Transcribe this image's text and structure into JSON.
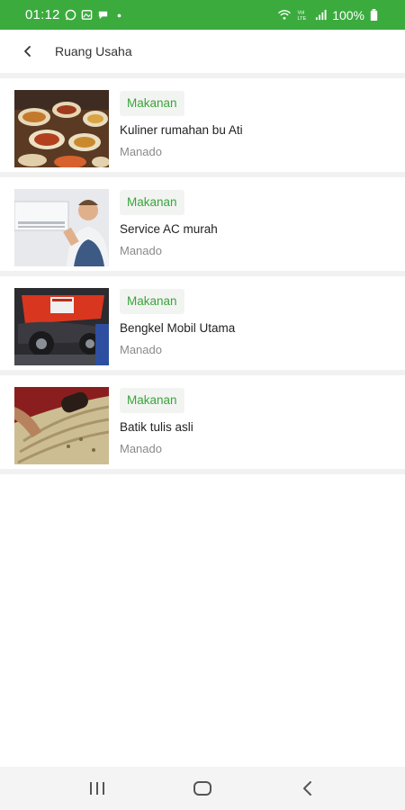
{
  "status_bar": {
    "time": "01:12",
    "battery": "100%",
    "left_icons": [
      "whatsapp-icon",
      "gallery-icon",
      "chat-icon",
      "dot-icon"
    ],
    "right_icons": [
      "wifi-icon",
      "volte-icon",
      "signal-icon",
      "battery-icon"
    ],
    "background": "#3bab3e"
  },
  "app_bar": {
    "title": "Ruang Usaha",
    "back_icon": "arrow-left-icon"
  },
  "items": [
    {
      "category": "Makanan",
      "title": "Kuliner rumahan bu Ati",
      "location": "Manado",
      "image": "food-platter-photo"
    },
    {
      "category": "Makanan",
      "title": "Service AC murah",
      "location": "Manado",
      "image": "ac-technician-photo"
    },
    {
      "category": "Makanan",
      "title": "Bengkel Mobil Utama",
      "location": "Manado",
      "image": "car-lift-photo"
    },
    {
      "category": "Makanan",
      "title": "Batik tulis asli",
      "location": "Manado",
      "image": "batik-canting-photo"
    }
  ],
  "nav_bar": {
    "buttons": [
      "recents-icon",
      "home-icon",
      "back-icon"
    ]
  },
  "colors": {
    "accent": "#3bab3e",
    "badge_text": "#3aa43a",
    "badge_bg": "#f2f4f2"
  }
}
